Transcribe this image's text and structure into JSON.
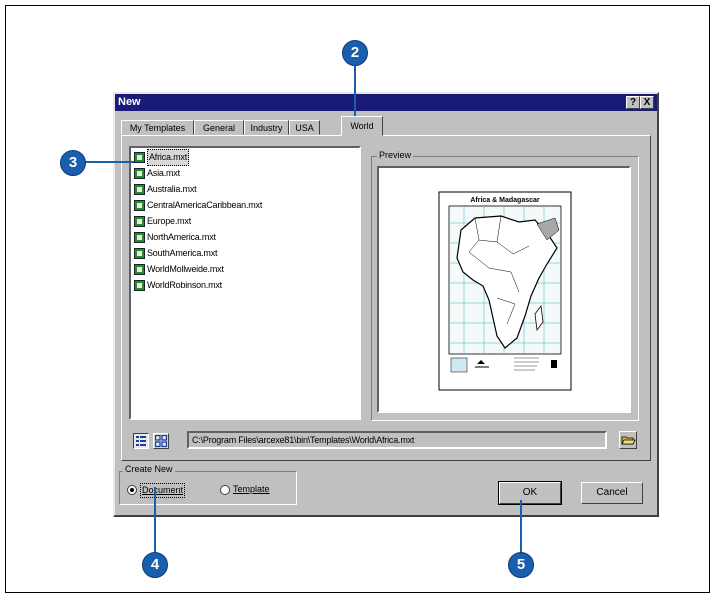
{
  "dialog": {
    "title": "New",
    "help_button": "?",
    "close_button": "X"
  },
  "tabs": [
    {
      "label": "My Templates"
    },
    {
      "label": "General"
    },
    {
      "label": "Industry"
    },
    {
      "label": "USA"
    },
    {
      "label": "World"
    }
  ],
  "active_tab": "World",
  "templates": [
    {
      "label": "Africa.mxt"
    },
    {
      "label": "Asia.mxt"
    },
    {
      "label": "Australia.mxt"
    },
    {
      "label": "CentralAmericaCaribbean.mxt"
    },
    {
      "label": "Europe.mxt"
    },
    {
      "label": "NorthAmerica.mxt"
    },
    {
      "label": "SouthAmerica.mxt"
    },
    {
      "label": "WorldMollweide.mxt"
    },
    {
      "label": "WorldRobinson.mxt"
    }
  ],
  "selected_template": "Africa.mxt",
  "preview": {
    "caption": "Preview",
    "map_title": "Africa & Madagascar"
  },
  "path": {
    "value": "C:\\Program Files\\arcexe81\\bin\\Templates\\World\\Africa.mxt"
  },
  "create_new": {
    "caption": "Create New",
    "document_label": "Document",
    "template_label": "Template",
    "selected": "Document"
  },
  "buttons": {
    "ok": "OK",
    "cancel": "Cancel"
  },
  "callouts": [
    "2",
    "3",
    "4",
    "5"
  ],
  "colors": {
    "title_bar": "#1a1a78",
    "callout": "#1a5fae",
    "dialog_face": "#c0c0c0"
  }
}
